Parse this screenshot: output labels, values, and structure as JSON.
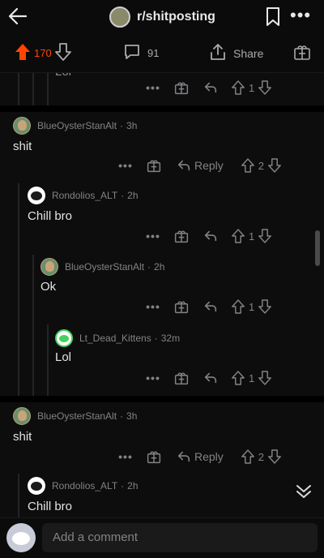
{
  "header": {
    "subreddit": "r/shitposting",
    "back_icon": "arrow-left-icon",
    "bookmark_icon": "bookmark-icon",
    "more_label": "•••"
  },
  "post_actions": {
    "upvotes": "170",
    "comments": "91",
    "share": "Share",
    "upvote_color": "#ff4500"
  },
  "partial_top": {
    "vote_count": "1",
    "dots": "•••"
  },
  "comments": [
    {
      "author": "BlueOysterStanAlt",
      "time": "3h",
      "text": "shit",
      "reply": "Reply",
      "votes": "2",
      "dots": "•••"
    },
    {
      "author": "Rondolios_ALT",
      "time": "2h",
      "text": "Chill bro",
      "votes": "1",
      "dots": "•••"
    },
    {
      "author": "BlueOysterStanAlt",
      "time": "2h",
      "text": "Ok",
      "votes": "1",
      "dots": "•••"
    },
    {
      "author": "Lt_Dead_Kittens",
      "time": "32m",
      "text": "Lol",
      "votes": "1",
      "dots": "•••"
    },
    {
      "author": "BlueOysterStanAlt",
      "time": "3h",
      "text": "shit",
      "reply": "Reply",
      "votes": "2",
      "dots": "•••"
    },
    {
      "author": "Rondolios_ALT",
      "time": "2h",
      "text": "Chill bro"
    }
  ],
  "composer": {
    "placeholder": "Add a comment"
  }
}
